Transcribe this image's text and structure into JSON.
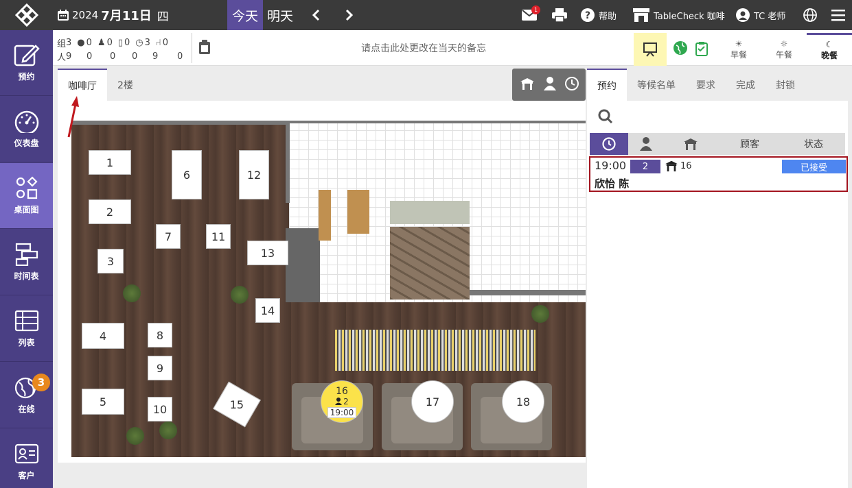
{
  "topbar": {
    "year": "2024",
    "month_day": "7月11日",
    "weekday": "四",
    "today_label": "今天",
    "tomorrow_label": "明天",
    "mail_count": "1",
    "help_label": "帮助",
    "store_label": "TableCheck 咖啡",
    "user_label": "TC 老师"
  },
  "sidebar": {
    "items": [
      {
        "label": "预约",
        "icon": "pencil-icon"
      },
      {
        "label": "仪表盘",
        "icon": "gauge-icon"
      },
      {
        "label": "桌面图",
        "icon": "shapes-icon"
      },
      {
        "label": "时间表",
        "icon": "timeline-icon"
      },
      {
        "label": "列表",
        "icon": "list-icon"
      },
      {
        "label": "在线",
        "icon": "globe-icon",
        "badge": "3"
      },
      {
        "label": "客户",
        "icon": "customer-card-icon"
      }
    ]
  },
  "stats": {
    "group_label": "组",
    "people_label": "人",
    "groups": [
      "3",
      "0",
      "0",
      "0",
      "3",
      "0"
    ],
    "people": [
      "9",
      "0",
      "0",
      "0",
      "9",
      "0"
    ]
  },
  "memo_placeholder": "请点击此处更改在当天的备忘",
  "meals": [
    {
      "label": "早餐",
      "icon": "sunrise-icon"
    },
    {
      "label": "午餐",
      "icon": "sun-icon"
    },
    {
      "label": "晚餐",
      "icon": "moon-icon"
    }
  ],
  "floor_tabs": [
    "咖啡厅",
    "2楼"
  ],
  "tables": [
    "1",
    "2",
    "3",
    "4",
    "5",
    "6",
    "7",
    "8",
    "9",
    "10",
    "11",
    "12",
    "13",
    "14",
    "15",
    "16",
    "17",
    "18"
  ],
  "occupied_table": {
    "number": "16",
    "guests": "2",
    "time": "19:00"
  },
  "right_tabs": [
    "预约",
    "等候名单",
    "要求",
    "完成",
    "封锁"
  ],
  "list_headers": {
    "customer": "顾客",
    "status": "状态"
  },
  "reservation": {
    "time": "19:00",
    "party": "2",
    "table": "16",
    "status": "已接受",
    "name": "欣怡 陈"
  }
}
